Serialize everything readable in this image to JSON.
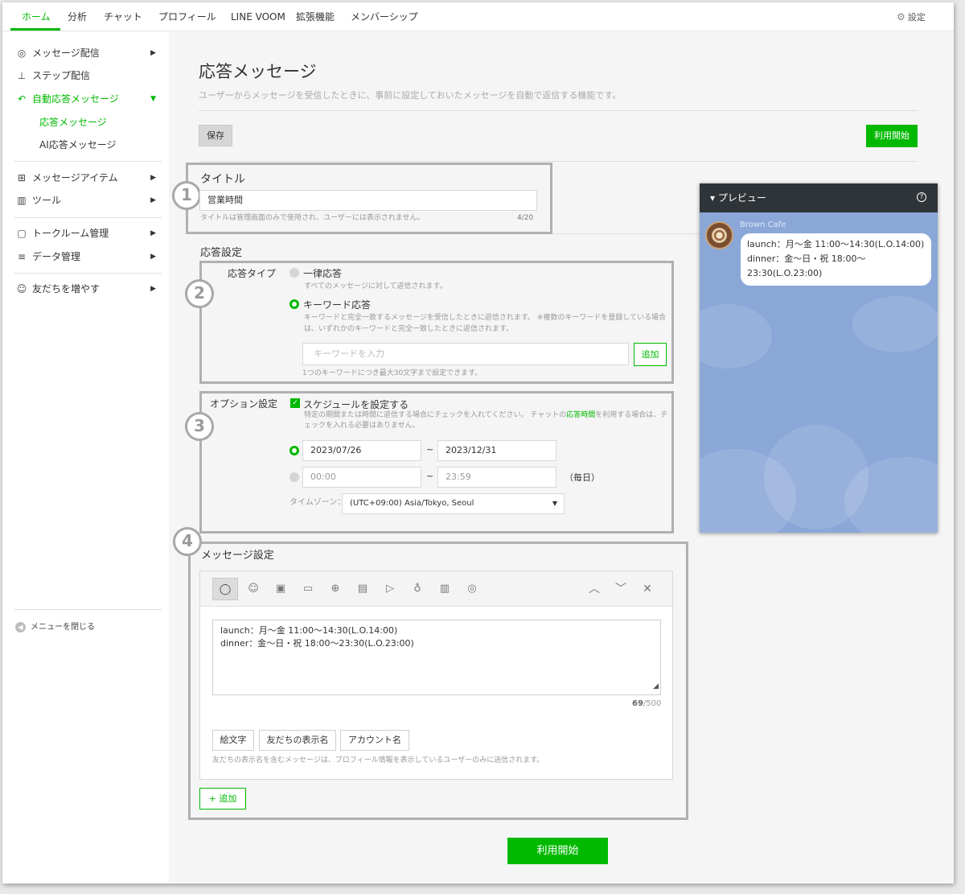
{
  "topnav": {
    "tabs": [
      "ホーム",
      "分析",
      "チャット",
      "プロフィール",
      "LINE VOOM",
      "拡張機能",
      "メンバーシップ"
    ],
    "settings_label": "設定"
  },
  "sidebar": {
    "items": [
      {
        "label": "メッセージ配信"
      },
      {
        "label": "ステップ配信"
      },
      {
        "label": "自動応答メッセージ"
      },
      {
        "label": "メッセージアイテム"
      },
      {
        "label": "ツール"
      },
      {
        "label": "トークルーム管理"
      },
      {
        "label": "データ管理"
      },
      {
        "label": "友だちを増やす"
      }
    ],
    "sub_items": [
      "応答メッセージ",
      "AI応答メッセージ"
    ],
    "close_label": "メニューを閉じる"
  },
  "page": {
    "title": "応答メッセージ",
    "description": "ユーザーからメッセージを受信したときに、事前に設定しておいたメッセージを自動で返信する機能です。",
    "save_label": "保存",
    "start_label": "利用開始"
  },
  "badges": [
    "1",
    "2",
    "3",
    "4"
  ],
  "title_section": {
    "label": "タイトル",
    "value": "営業時間",
    "hint": "タイトルは管理画面のみで使用され、ユーザーには表示されません。",
    "counter": "4/20"
  },
  "response_settings": {
    "heading": "応答設定",
    "type_label": "応答タイプ",
    "option_all": "一律応答",
    "option_all_hint": "すべてのメッセージに対して返信されます。",
    "option_keyword": "キーワード応答",
    "option_keyword_hint_1": "キーワードと完全一致するメッセージを受信したときに返信されます。 ※複数のキーワードを登録している場合",
    "option_keyword_hint_2": "は、いずれかのキーワードと完全一致したときに返信されます。",
    "keyword_placeholder": "キーワードを入力",
    "add_label": "追加",
    "keyword_hint": "1つのキーワードにつき最大30文字まで設定できます。"
  },
  "option_settings": {
    "label": "オプション設定",
    "schedule_label": "スケジュールを設定する",
    "hint_1a": "特定の期間または時間に返信する場合にチェックを入れてください。 チャットの",
    "hint_1_link": "応答時間",
    "hint_1b": "を利用する場合は、チ",
    "hint_2": "ェックを入れる必要はありません。",
    "date_start": "2023/07/26",
    "date_end": "2023/12/31",
    "tilde": "~",
    "time_start": "00:00",
    "time_end": "23:59",
    "daily_label": "（毎日）",
    "timezone_label": "タイムゾーン：",
    "timezone_value": "(UTC+09:00) Asia/Tokyo, Seoul"
  },
  "message_settings": {
    "heading": "メッセージ設定",
    "text_lines": [
      "launch：月～金 11:00～14:30(L.O.14:00)",
      "dinner：金～日・祝 18:00～23:30(L.O.23:00)"
    ],
    "counter_used": "69",
    "counter_max": "/500",
    "insert_buttons": [
      "絵文字",
      "友だちの表示名",
      "アカウント名"
    ],
    "insert_hint": "友だちの表示名を含むメッセージは、プロフィール情報を表示しているユーザーのみに送信されます。",
    "add_label": "+ 追加"
  },
  "preview": {
    "title": "プレビュー",
    "account_name": "Brown Cafe",
    "bubble_lines": [
      "launch：月～金 11:00～14:30(L.O.14:00)",
      "dinner：金～日・祝 18:00～",
      "23:30(L.O.23:00)"
    ]
  },
  "colors": {
    "accent": "#00b900",
    "preview_bg": "#8aa7d8",
    "preview_header": "#2f3438",
    "annotation": "#b0b0b0"
  }
}
